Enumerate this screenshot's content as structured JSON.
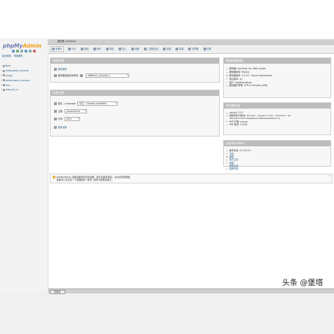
{
  "sidebar": {
    "logo_php": "php",
    "logo_my": "My",
    "logo_admin": "Admin",
    "links": [
      "最近使用",
      "表收藏夹"
    ],
    "databases": [
      "New",
      "information_schema",
      "mysql",
      "performance_schema",
      "test",
      "www_t8_cn"
    ]
  },
  "topbar": {
    "crumb": "服务器: localhost"
  },
  "tabs": [
    {
      "label": "数据库",
      "icon": "database-icon",
      "active": true
    },
    {
      "label": "SQL",
      "icon": "sql-icon",
      "active": false
    },
    {
      "label": "状态",
      "icon": "status-icon",
      "active": false
    },
    {
      "label": "用户",
      "icon": "users-icon",
      "active": false
    },
    {
      "label": "导出",
      "icon": "export-icon",
      "active": false
    },
    {
      "label": "导入",
      "icon": "import-icon",
      "active": false
    },
    {
      "label": "设置",
      "icon": "settings-icon",
      "active": false
    },
    {
      "label": "二进制日志",
      "icon": "binlog-icon",
      "active": false
    },
    {
      "label": "复制",
      "icon": "replication-icon",
      "active": false
    },
    {
      "label": "变量",
      "icon": "variables-icon",
      "active": false
    },
    {
      "label": "字符集",
      "icon": "charset-icon",
      "active": false
    },
    {
      "label": "引擎",
      "icon": "engine-icon",
      "active": false
    }
  ],
  "general_settings": {
    "title": "常规设置",
    "change_password": "修改密码",
    "collation_label": "服务器连接排序规则:",
    "collation_value": "utf8mb4_unicode_ci"
  },
  "appearance": {
    "title": "外观设置",
    "language_label": "语言 - Language",
    "language_value": "中文 - Chinese simplified",
    "theme_label": "主题:",
    "theme_value": "pmahomme",
    "font_label": "字号:",
    "font_value": "82%",
    "more_settings": "更多设置"
  },
  "db_server": {
    "title": "数据库服务器",
    "items": [
      "服务器: localhost via UNIX socket",
      "服务器类型: MySQL",
      "服务器版本: 5.5.53 - Source distribution",
      "协议版本: 10",
      "用户: root@localhost",
      "服务器字符集: UTF-8 Unicode (utf8)"
    ]
  },
  "web_server": {
    "title": "网站服务器",
    "items": [
      "nginx/1.13.1",
      "数据库客户端版本: libmysql - mysqlnd 5.0.10 - 20111026 - $Id: c85105d7c6f7d70d609bac5c6f63d9e4ad0f01dc $",
      "PHP 扩展: mysqli",
      "PHP 版本: 5.6.40"
    ]
  },
  "phpmyadmin": {
    "title": "phpMyAdmin",
    "items": [
      "版本信息: 4.4.15.10",
      "文档",
      "维基",
      "官方主页",
      "贡献",
      "获取支持",
      "更新列表"
    ]
  },
  "notice": {
    "line1": "phpMyAdmin 高级功能尚未完全设置，部分功能未激活。请点此查找原因。",
    "line2": "或者可以去任意一个数据库的 \"操作\" 选项卡那里设置它。"
  },
  "console": {
    "label": "控制台"
  },
  "watermark": "头条 @堡塔",
  "colors": {
    "panel_header": "#bdbdbd",
    "link": "#235a81",
    "logo_blue": "#6c78af",
    "logo_orange": "#f59f19"
  }
}
